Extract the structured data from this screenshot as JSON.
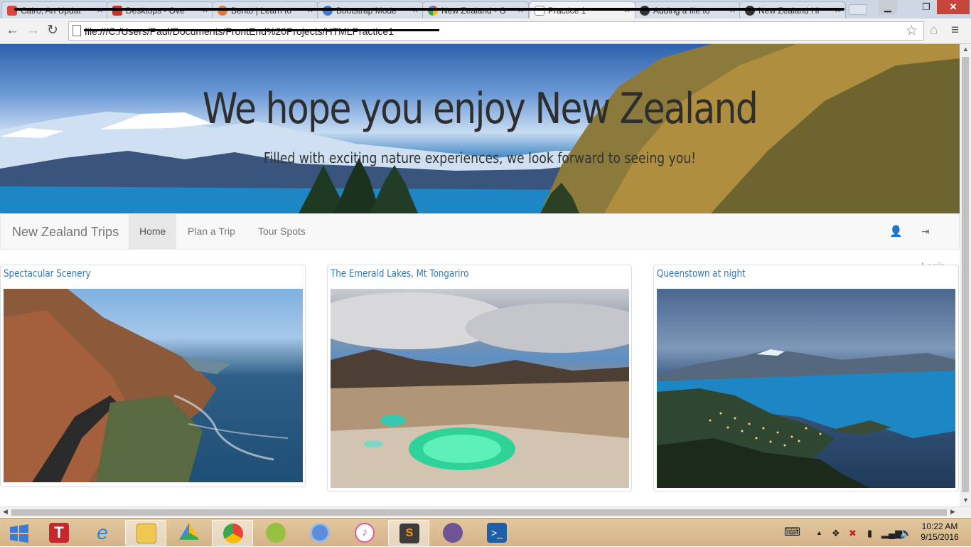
{
  "browser": {
    "tabs": [
      {
        "label": "Cairo, An Updat"
      },
      {
        "label": "Desktops - Ove"
      },
      {
        "label": "Bento | Learn to"
      },
      {
        "label": "Bootstrap Mode"
      },
      {
        "label": "New Zealand - G"
      },
      {
        "label": "Practice 1"
      },
      {
        "label": "Adding a file to"
      },
      {
        "label": "New Zealand Hi"
      }
    ],
    "url": "file:///C:/Users/Paul/Documents/FrontEnd%20Projects/HTMLPractice1"
  },
  "hero": {
    "title": "We hope you enjoy New Zealand",
    "subtitle": "Filled with exciting nature experiences, we look forward to seeing you!"
  },
  "navbar": {
    "brand": "New Zealand Trips",
    "items": [
      {
        "label": "Home"
      },
      {
        "label": "Plan a Trip"
      },
      {
        "label": "Tour Spots"
      }
    ],
    "login": "Login"
  },
  "cards": [
    {
      "title": "Spectacular Scenery"
    },
    {
      "title": "The Emerald Lakes, Mt Tongariro"
    },
    {
      "title": "Queenstown at night"
    }
  ],
  "taskbar": {
    "time": "10:22 AM",
    "date": "9/15/2016"
  },
  "colors": {
    "navbar_bg": "#f8f8f8",
    "link": "#337ab7",
    "taskbar": "#d4b387"
  }
}
